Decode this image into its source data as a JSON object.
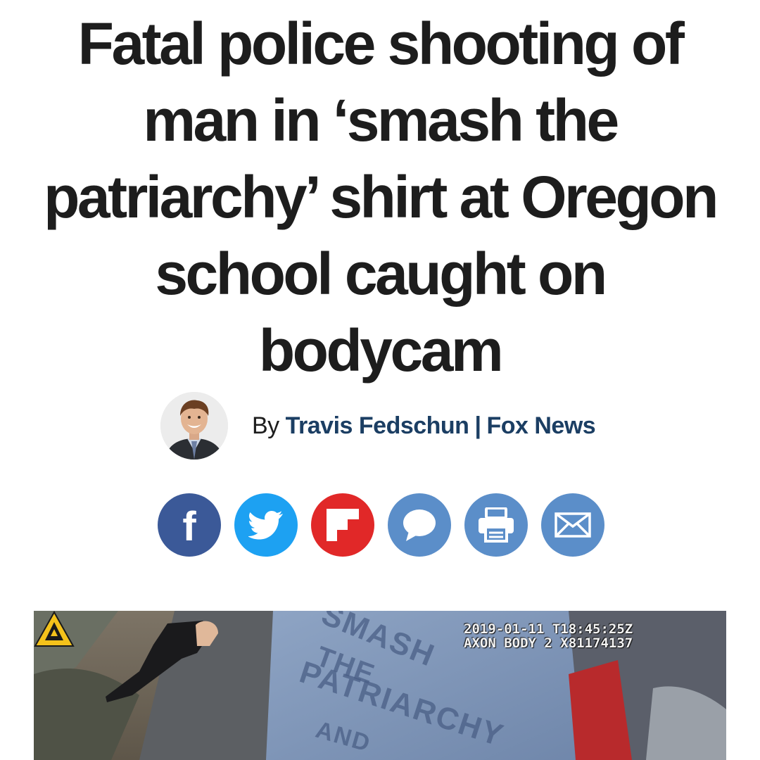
{
  "article": {
    "headline": "Fatal police shooting of man in ‘smash the patriarchy’ shirt at Oregon school caught on bodycam",
    "byline": {
      "prefix": "By",
      "author": "Travis Fedschun",
      "separator": "|",
      "publisher": "Fox News"
    }
  },
  "share_buttons": [
    {
      "name": "facebook",
      "icon": "facebook-icon",
      "glyph": "f",
      "color": "#3b5998"
    },
    {
      "name": "twitter",
      "icon": "twitter-bird-icon",
      "color": "#1da1f2"
    },
    {
      "name": "flipboard",
      "icon": "flipboard-icon",
      "color": "#e12828"
    },
    {
      "name": "comments",
      "icon": "speech-bubble-icon",
      "color": "#5b8ec9"
    },
    {
      "name": "print",
      "icon": "printer-icon",
      "color": "#5b8ec9"
    },
    {
      "name": "email",
      "icon": "envelope-icon",
      "color": "#5b8ec9"
    }
  ],
  "video": {
    "timestamp": "2019-01-11 T18:45:25Z",
    "camera_id": "AXON BODY 2 X81174137",
    "shirt_text": [
      "SMASH",
      "THE",
      "PATRIARCHY",
      "AND"
    ]
  },
  "colors": {
    "headline": "#1d1d1d",
    "byline_link": "#1b3e63"
  }
}
